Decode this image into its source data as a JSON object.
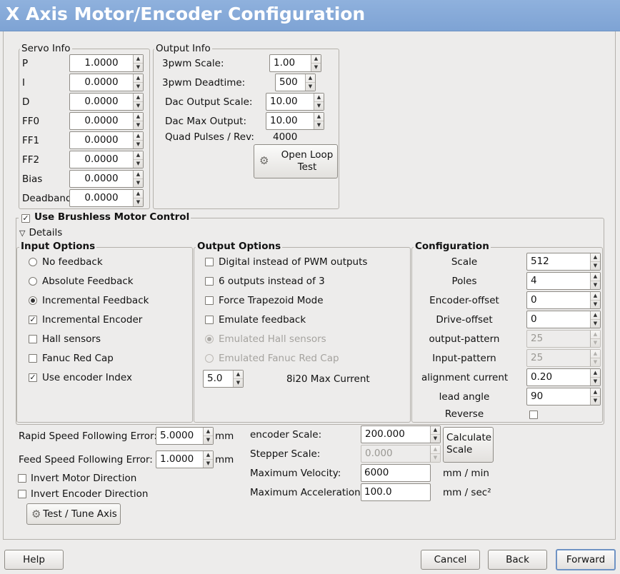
{
  "window": {
    "title": "X Axis Motor/Encoder Configuration"
  },
  "servo_info": {
    "title": "Servo Info",
    "fields": [
      {
        "label": "P",
        "value": "1.0000"
      },
      {
        "label": "I",
        "value": "0.0000"
      },
      {
        "label": "D",
        "value": "0.0000"
      },
      {
        "label": "FF0",
        "value": "0.0000"
      },
      {
        "label": "FF1",
        "value": "0.0000"
      },
      {
        "label": "FF2",
        "value": "0.0000"
      },
      {
        "label": "Bias",
        "value": "0.0000"
      },
      {
        "label": "Deadband",
        "value": "0.0000"
      }
    ]
  },
  "output_info": {
    "title": "Output Info",
    "pwm_scale_label": "3pwm Scale:",
    "pwm_scale": "1.00",
    "pwm_deadtime_label": "3pwm Deadtime:",
    "pwm_deadtime": "500",
    "dac_scale_label": "Dac Output Scale:",
    "dac_scale": "10.00",
    "dac_max_label": "Dac Max Output:",
    "dac_max": "10.00",
    "quad_label": "Quad Pulses / Rev:",
    "quad_value": "4000",
    "open_loop_line1": "Open Loop",
    "open_loop_line2": "Test"
  },
  "brushless": {
    "label": "Use Brushless Motor Control",
    "checked": true,
    "details_label": "Details"
  },
  "input_options": {
    "title": "Input Options",
    "no_feedback": "No feedback",
    "absolute_feedback": "Absolute Feedback",
    "incremental_feedback": "Incremental Feedback",
    "incremental_encoder": "Incremental Encoder",
    "hall_sensors": "Hall sensors",
    "fanuc_red_cap": "Fanuc Red Cap",
    "use_encoder_index": "Use encoder Index"
  },
  "output_options": {
    "title": "Output Options",
    "digital_pwm": "Digital instead of PWM outputs",
    "six_outputs": "6 outputs instead of 3",
    "force_trapezoid": "Force Trapezoid Mode",
    "emulate_feedback": "Emulate feedback",
    "emulated_hall": "Emulated Hall sensors",
    "emulated_fanuc": "Emulated Fanuc Red Cap",
    "max_current_value": "5.0",
    "max_current_label": "8i20 Max Current"
  },
  "configuration": {
    "title": "Configuration",
    "scale_label": "Scale",
    "scale": "512",
    "poles_label": "Poles",
    "poles": "4",
    "encoder_offset_label": "Encoder-offset",
    "encoder_offset": "0",
    "drive_offset_label": "Drive-offset",
    "drive_offset": "0",
    "output_pattern_label": "output-pattern",
    "output_pattern": "25",
    "input_pattern_label": "Input-pattern",
    "input_pattern": "25",
    "alignment_current_label": "alignment current",
    "alignment_current": "0.20",
    "lead_angle_label": "lead angle",
    "lead_angle": "90",
    "reverse_label": "Reverse"
  },
  "following": {
    "rapid_label": "Rapid Speed Following Error:",
    "rapid_value": "5.0000",
    "feed_label": "Feed Speed Following Error:",
    "feed_value": "1.0000",
    "unit": "mm",
    "invert_motor": "Invert Motor Direction",
    "invert_encoder": "Invert Encoder Direction",
    "test_tune": "Test / Tune Axis"
  },
  "scales": {
    "encoder_scale_label": "encoder Scale:",
    "encoder_scale": "200.000",
    "stepper_scale_label": "Stepper Scale:",
    "stepper_scale": "0.000",
    "calc_line1": "Calculate",
    "calc_line2": "Scale",
    "max_velocity_label": "Maximum Velocity:",
    "max_velocity": "6000",
    "max_velocity_unit": "mm / min",
    "max_accel_label": "Maximum Acceleration:",
    "max_accel": "100.0",
    "max_accel_unit": "mm / sec²"
  },
  "footer": {
    "help": "Help",
    "cancel": "Cancel",
    "back": "Back",
    "forward": "Forward"
  }
}
